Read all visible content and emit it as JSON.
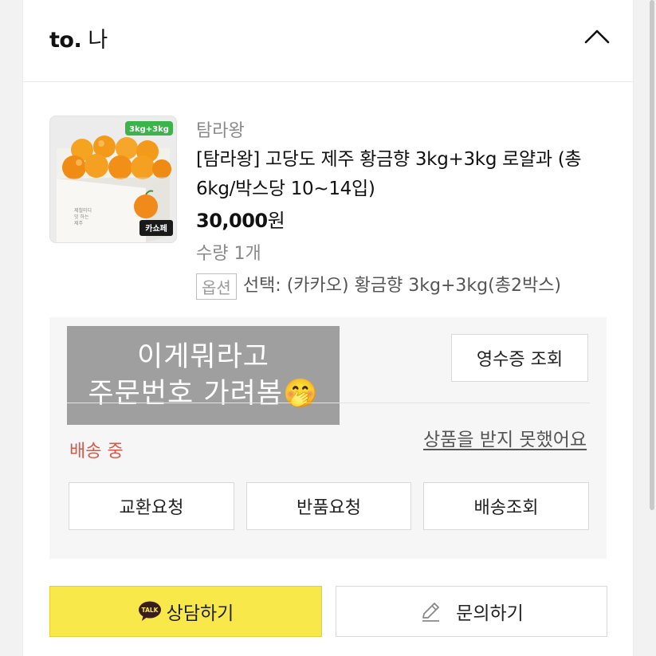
{
  "header": {
    "recipient_prefix": "to.",
    "recipient_name": "나",
    "collapse_icon": "chevron-up-icon"
  },
  "product": {
    "image_badge": "3kg+3kg",
    "image_tag": "카쇼페",
    "image_box_text": "제철미디\n잇 하는\n제주",
    "seller": "탐라왕",
    "title": "[탐라왕] 고당도 제주 황금향 3kg+3kg 로얄과 (총6kg/박스당 10~14입)",
    "price_value": "30,000",
    "price_unit": "원",
    "quantity": "수량 1개",
    "option_tag": "옵션",
    "option_text": "선택: (카카오) 황금향 3kg+3kg(총2박스)"
  },
  "order_panel": {
    "mask_line1": "이게뭐라고",
    "mask_line2": "주문번호 가려봄🤭",
    "receipt_button": "영수증 조회",
    "not_received_link": "상품을 받지 못했어요",
    "status": "배송 중",
    "actions": [
      "교환요청",
      "반품요청",
      "배송조회"
    ]
  },
  "bottom": {
    "consult_label": "상담하기",
    "talk_badge": "TALK",
    "inquiry_label": "문의하기"
  },
  "colors": {
    "status_red": "#d65a4a",
    "kakao_yellow": "#f8e84a",
    "mask_gray": "#9f9f9f"
  }
}
